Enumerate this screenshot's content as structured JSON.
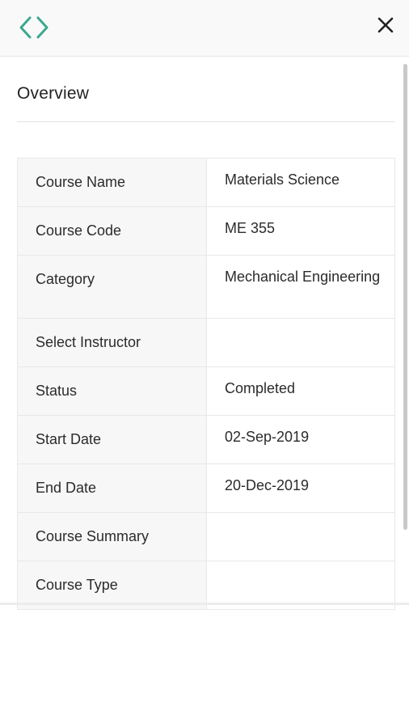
{
  "header": {
    "nav_icon": "code-brackets-icon",
    "close_icon": "close-icon",
    "accent_color": "#3aa88f"
  },
  "overview": {
    "title": "Overview",
    "rows": [
      {
        "label": "Course Name",
        "value": "Materials Science"
      },
      {
        "label": "Course Code",
        "value": "ME 355"
      },
      {
        "label": "Category",
        "value": "Mechanical Engineering"
      },
      {
        "label": "Select Instructor",
        "value": ""
      },
      {
        "label": "Status",
        "value": "Completed"
      },
      {
        "label": "Start Date",
        "value": "02-Sep-2019"
      },
      {
        "label": "End Date",
        "value": "20-Dec-2019"
      },
      {
        "label": "Course Summary",
        "value": ""
      },
      {
        "label": "Course Type",
        "value": ""
      }
    ]
  }
}
